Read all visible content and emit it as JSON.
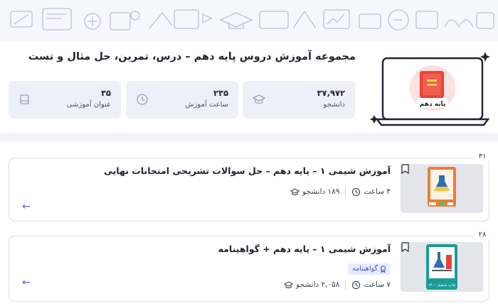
{
  "header": {
    "title": "مجموعه آموزش دروس پایه دهم – درس، تمرین، حل مثال و تست",
    "cover_label": "پایه دهم"
  },
  "stats": [
    {
      "value": "۳۷,۹۷۲",
      "label": "دانشجو",
      "icon": "graduation-cap-icon"
    },
    {
      "value": "۲۳۵",
      "label": "ساعت آموزش",
      "icon": "clock-icon"
    },
    {
      "value": "۳۵",
      "label": "عنوان آموزشی",
      "icon": "book-icon"
    }
  ],
  "courses": [
    {
      "index": "۳۱",
      "title": "آموزش شیمی ۱ – پایه دهم – حل سوالات تشریحی امتحانات نهایی",
      "students": "۱۸۹ دانشجو",
      "hours": "۴ ساعت",
      "arrow": "←"
    },
    {
      "index": "۲۸",
      "title": "آموزش شیمی ۱ – پایه دهم + گواهینامه",
      "certificate": "گواهینامه",
      "students": "۲,۰۵۸ دانشجو",
      "hours": "۷ ساعت",
      "thumb_caption": "چاپ ششم ۱۴۰۰",
      "arrow": "←"
    }
  ],
  "colors": {
    "accent": "#4a64e8",
    "stat_bg": "#eef0f9",
    "book_red": "#e8433a",
    "book_orange": "#ee7c33",
    "book_teal": "#1c9c96"
  }
}
